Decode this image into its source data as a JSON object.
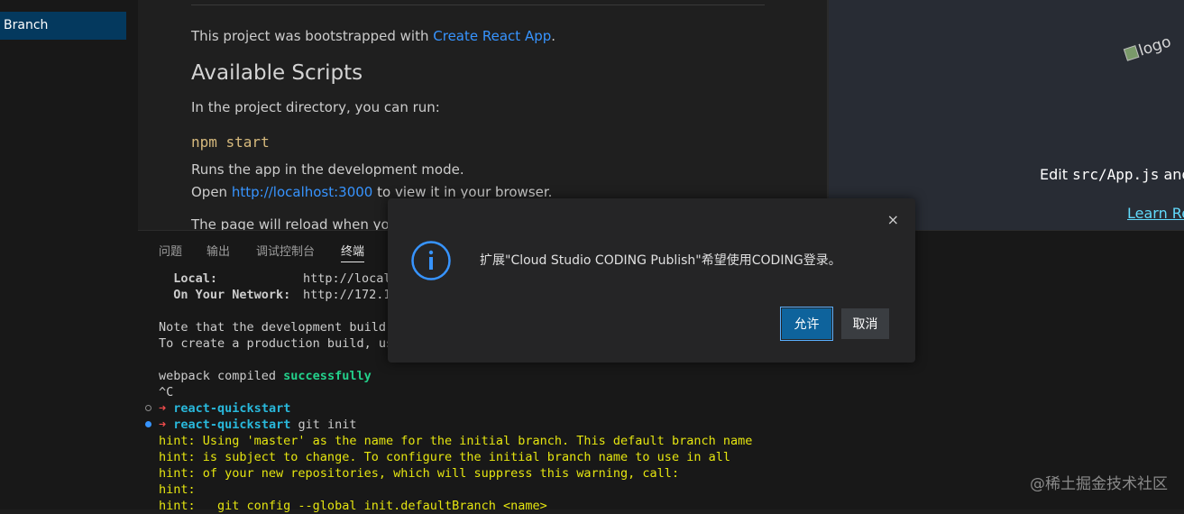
{
  "sidebar": {
    "branch_label": "Branch"
  },
  "readme": {
    "intro_text": "This project was bootstrapped with ",
    "intro_link": "Create React App",
    "intro_end": ".",
    "heading": "Available Scripts",
    "dir_text": "In the project directory, you can run:",
    "command": "npm start",
    "runs_text": "Runs the app in the development mode.",
    "open_text": "Open ",
    "open_link": "http://localhost:3000",
    "open_end": " to view it in your browser.",
    "reload_text": "The page will reload when you"
  },
  "browser": {
    "logo_alt": "logo",
    "edit_prefix": "Edit ",
    "edit_code": "src/App.js",
    "edit_suffix": " and",
    "learn_link": "Learn Re"
  },
  "panel": {
    "tabs": [
      {
        "label": "问题"
      },
      {
        "label": "输出"
      },
      {
        "label": "调试控制台"
      },
      {
        "label": "终端"
      }
    ],
    "active_tab": "终端",
    "terminal": {
      "local_label": "  Local:",
      "local_url": "http://local",
      "network_label": "  On Your Network:",
      "network_url": "http://172.1",
      "note_line": "Note that the development build",
      "create_line": "To create a production build, us",
      "webpack_prefix": "webpack compiled ",
      "webpack_status": "successfully",
      "ctrl_c": "^C",
      "arrow": "➜",
      "prompt_dir": "react-quickstart",
      "command": " git init",
      "hints": [
        "hint: Using 'master' as the name for the initial branch. This default branch name",
        "hint: is subject to change. To configure the initial branch name to use in all",
        "hint: of your new repositories, which will suppress this warning, call:",
        "hint:",
        "hint:   git config --global init.defaultBranch <name>"
      ]
    }
  },
  "dialog": {
    "message": "扩展\"Cloud Studio CODING Publish\"希望使用CODING登录。",
    "allow_label": "允许",
    "cancel_label": "取消",
    "close_symbol": "×"
  },
  "watermark": "@稀土掘金技术社区",
  "colors": {
    "accent_blue": "#3794ff",
    "button_primary": "#0e639c",
    "success_green": "#23d18b",
    "prompt_cyan": "#29b8db",
    "hint_yellow": "#e5e510"
  }
}
